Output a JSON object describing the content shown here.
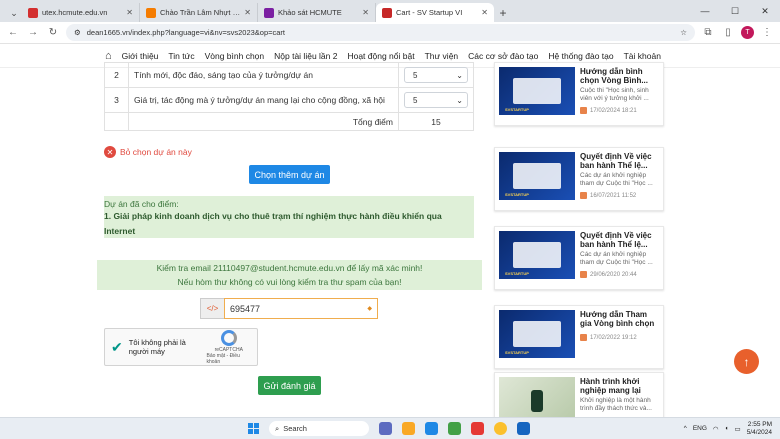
{
  "browser": {
    "tabs": [
      {
        "title": "utex.hcmute.edu.vn",
        "color": "#d32f2f",
        "active": false
      },
      {
        "title": "Chào Trần Lâm Nhựt Khang! Cá",
        "color": "#f57c00",
        "active": false
      },
      {
        "title": "Khảo sát HCMUTE",
        "color": "#7b1fa2",
        "active": false
      },
      {
        "title": "Cart - SV Startup VI",
        "color": "#c62828",
        "active": true
      }
    ],
    "url": "dean1665.vn/index.php?language=vi&nv=svs2023&op=cart",
    "avatar_letter": "T"
  },
  "site_nav": {
    "items": [
      "Giới thiệu",
      "Tin tức",
      "Vòng bình chọn",
      "Nộp tài liệu lần 2",
      "Hoạt động nổi bật",
      "Thư viện",
      "Các cơ sở đào tạo",
      "Hệ thống đào tạo",
      "Tài khoản"
    ]
  },
  "score_table": {
    "rows": [
      {
        "num": "2",
        "criterion": "Tính mới, độc đáo, sáng tạo của ý tưởng/dự án",
        "score": "5"
      },
      {
        "num": "3",
        "criterion": "Giá trị, tác động mà ý tưởng/dự án mang lại cho cộng đồng, xã hội",
        "score": "5"
      }
    ],
    "total_label": "Tổng điểm",
    "total_value": "15"
  },
  "remove_label": "Bỏ chọn dự án này",
  "choose_more_label": "Chọn thêm dự án",
  "chosen": {
    "label": "Dự án đã cho điểm:",
    "project": "1. Giải pháp kinh doanh dịch vụ cho thuê trạm thí nghiệm thực hành điều khiển qua Internet"
  },
  "verify": {
    "line1": "Kiểm tra email 21110497@student.hcmute.edu.vn để lấy mã xác minh!",
    "line2": "Nếu hòm thư không có vui lòng kiểm tra thư spam của bạn!"
  },
  "code_field": {
    "addon": "</>",
    "value": "695477"
  },
  "captcha": {
    "text": "Tôi không phải là người máy",
    "brand": "reCAPTCHA",
    "links": "Bảo mật - Điều khoản"
  },
  "submit_label": "Gửi đánh giá",
  "sidebar": {
    "news": [
      {
        "title": "Hướng dẫn bình chọn Vòng Bình...",
        "desc": "Cuộc thi \"Học sinh, sinh viên với ý tưởng khởi ...",
        "date": "17/02/2024 18:21"
      },
      {
        "title": "Quyết định Về việc ban hành Thể lệ...",
        "desc": "Các dự án khởi nghiệp tham dự Cuộc thi \"Học ...",
        "date": "16/07/2021 11:52"
      },
      {
        "title": "Quyết định Về việc ban hành Thể lệ...",
        "desc": "Các dự án khởi nghiệp tham dự Cuộc thi \"Học ...",
        "date": "29/06/2020 20:44"
      },
      {
        "title": "Hướng dẫn Tham gia Vòng bình chọn -...",
        "desc": "",
        "date": "17/02/2022 19:12"
      },
      {
        "title": "Hành trình khởi nghiệp mang lại cho...",
        "desc": "Khởi nghiệp là một hành trình đầy thách thức và...",
        "date": ""
      }
    ]
  },
  "taskbar": {
    "search": "Search",
    "lang": "ENG",
    "time": "2:55 PM",
    "date": "5/4/2024"
  }
}
